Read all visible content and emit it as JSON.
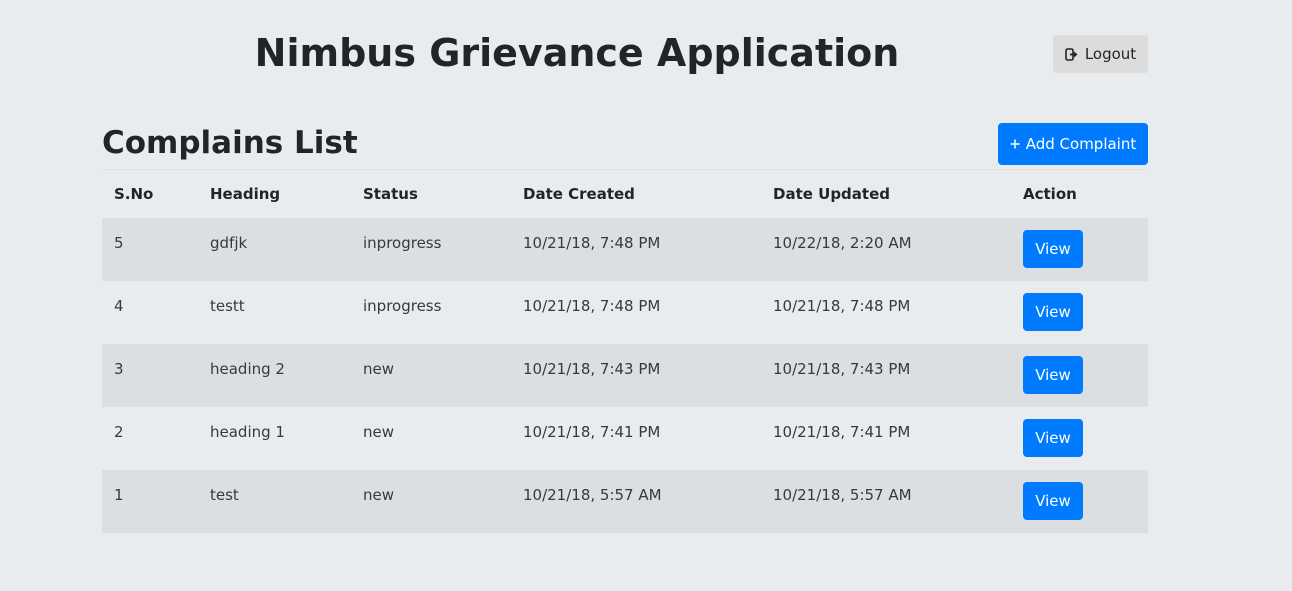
{
  "app": {
    "title": "Nimbus Grievance Application"
  },
  "header": {
    "logout_label": "Logout",
    "logout_icon": "sign-out-icon"
  },
  "list": {
    "title": "Complains List",
    "add_label": "Add Complaint",
    "add_icon": "plus-icon"
  },
  "table": {
    "columns": [
      "S.No",
      "Heading",
      "Status",
      "Date Created",
      "Date Updated",
      "Action"
    ],
    "rows": [
      {
        "sno": "5",
        "heading": "gdfjk",
        "status": "inprogress",
        "created": "10/21/18, 7:48 PM",
        "updated": "10/22/18, 2:20 AM",
        "action": "View"
      },
      {
        "sno": "4",
        "heading": "testt",
        "status": "inprogress",
        "created": "10/21/18, 7:48 PM",
        "updated": "10/21/18, 7:48 PM",
        "action": "View"
      },
      {
        "sno": "3",
        "heading": "heading 2",
        "status": "new",
        "created": "10/21/18, 7:43 PM",
        "updated": "10/21/18, 7:43 PM",
        "action": "View"
      },
      {
        "sno": "2",
        "heading": "heading 1",
        "status": "new",
        "created": "10/21/18, 7:41 PM",
        "updated": "10/21/18, 7:41 PM",
        "action": "View"
      },
      {
        "sno": "1",
        "heading": "test",
        "status": "new",
        "created": "10/21/18, 5:57 AM",
        "updated": "10/21/18, 5:57 AM",
        "action": "View"
      }
    ]
  },
  "colors": {
    "background": "#e9ecef",
    "primary": "#007bff",
    "row_shade": "#dcdfe2",
    "logout_bg": "#dcdcdc"
  }
}
